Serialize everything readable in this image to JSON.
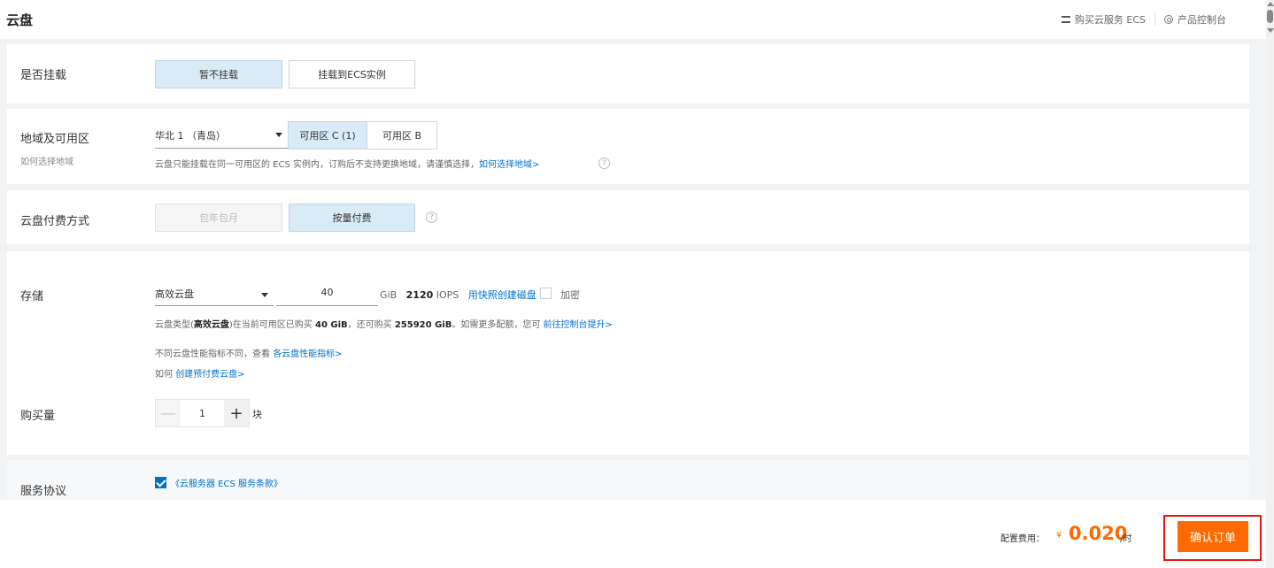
{
  "header": {
    "title": "云盘",
    "buy_ecs": "购买云服务 ECS",
    "console": "产品控制台"
  },
  "mount": {
    "label": "是否挂载",
    "options": [
      "暂不挂载",
      "挂载到ECS实例"
    ],
    "selected": "暂不挂载"
  },
  "region": {
    "label": "地域及可用区",
    "sublabel": "如何选择地域",
    "region_value": "华北 1 （青岛）",
    "zones": [
      "可用区 C (1)",
      "可用区 B"
    ],
    "selected_zone": "可用区 C (1)",
    "hint": "云盘只能挂载在同一可用区的 ECS 实例内，订购后不支持更换地域，请谨慎选择，",
    "hint_link": "如何选择地域>",
    "help": "?"
  },
  "billing": {
    "label": "云盘付费方式",
    "options": [
      "包年包月",
      "按量付费"
    ],
    "selected": "按量付费",
    "help": "?"
  },
  "storage": {
    "label": "存储",
    "type_value": "高效云盘",
    "size_value": "40",
    "unit": "GiB",
    "iops_number": "2120",
    "iops_unit": "IOPS",
    "snapshot_link": "用快照创建磁盘",
    "encrypt_label": "加密",
    "quota_prefix": "云盘类型(",
    "quota_type": "高效云盘",
    "quota_mid1": ")在当前可用区已购买 ",
    "quota_bought": "40 GiB",
    "quota_mid2": "，还可购买 ",
    "quota_remaining": "255920 GiB",
    "quota_suffix": "。如需更多配额，您可 ",
    "quota_link": "前往控制台提升>",
    "perf_text": "不同云盘性能指标不同，查看 ",
    "perf_link": "各云盘性能指标>",
    "prepaid_text": "如何 ",
    "prepaid_link": "创建预付费云盘>"
  },
  "quantity": {
    "label": "购买量",
    "minus": "—",
    "value": "1",
    "plus": "+",
    "unit": "块"
  },
  "agreement": {
    "label": "服务协议",
    "link": "《云服务器 ECS 服务条款》",
    "checked": true
  },
  "footer": {
    "fee_label": "配置费用：",
    "currency": "¥",
    "amount": "0.020",
    "unit": "/时",
    "confirm": "确认订单"
  },
  "colors": {
    "accent_blue": "#0070cc",
    "price_orange": "#ff6a00",
    "selected_bg": "#d9ebf7",
    "highlight_red": "#e11111"
  },
  "icons": [
    "server-icon",
    "gear-icon",
    "help-icon",
    "checkbox-icon"
  ]
}
